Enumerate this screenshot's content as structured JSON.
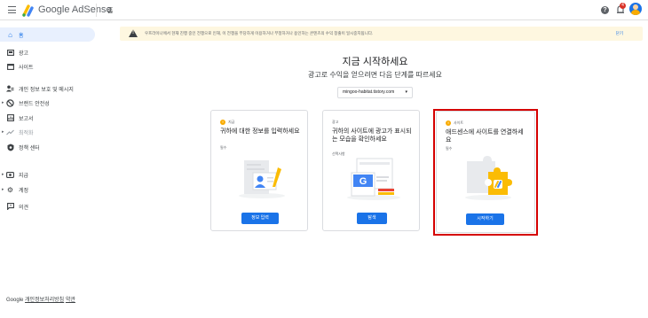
{
  "header": {
    "brand": "Google AdSense",
    "breadcrumb": "홈",
    "notification_count": "4"
  },
  "sidebar": {
    "items": [
      {
        "label": "홈",
        "icon": "home-icon",
        "active": true
      },
      {
        "label": "광고",
        "icon": "ads-icon"
      },
      {
        "label": "사이트",
        "icon": "sites-icon"
      },
      {
        "label": "개인 정보 보호 및 메시지",
        "icon": "privacy-icon"
      },
      {
        "label": "브랜드 안전성",
        "icon": "block-icon"
      },
      {
        "label": "보고서",
        "icon": "reports-icon"
      },
      {
        "label": "최적화",
        "icon": "optimize-icon"
      },
      {
        "label": "정책 센터",
        "icon": "policy-icon"
      },
      {
        "label": "지급",
        "icon": "payments-icon"
      },
      {
        "label": "계정",
        "icon": "account-icon"
      },
      {
        "label": "의견",
        "icon": "feedback-icon"
      }
    ],
    "footer": {
      "google": "Google",
      "privacy": "개인정보처리방침",
      "terms": "약관"
    }
  },
  "banner": {
    "text": "우프라이나에서 현재 진행 중인 전쟁으로 인해, 이 전쟁을 부당하게 이용하거나 부정하거나 용인하는 콘텐츠의 수익 창출이 일시중지됩니다.",
    "dismiss": "닫기"
  },
  "main": {
    "title": "지금 시작하세요",
    "subtitle": "광고로 수익을 얻으려면 다음 단계를 따르세요",
    "site_selector": "mingoo-habitat.tistory.com"
  },
  "cards": [
    {
      "step": "지급",
      "title": "귀하에 대한 정보를 입력하세요",
      "sub": "필수",
      "button": "정보 입력"
    },
    {
      "step": "광고",
      "title": "귀하의 사이트에 광고가 표시되는 모습을 확인하세요",
      "sub": "선택사항",
      "button": "탐색"
    },
    {
      "step": "사이트",
      "title": "애드센스에 사이트를 연결하세요",
      "sub": "필수",
      "button": "시작하기"
    }
  ],
  "colors": {
    "accent": "#1a73e8",
    "warning": "#f9ab00",
    "highlight": "#d50000"
  }
}
